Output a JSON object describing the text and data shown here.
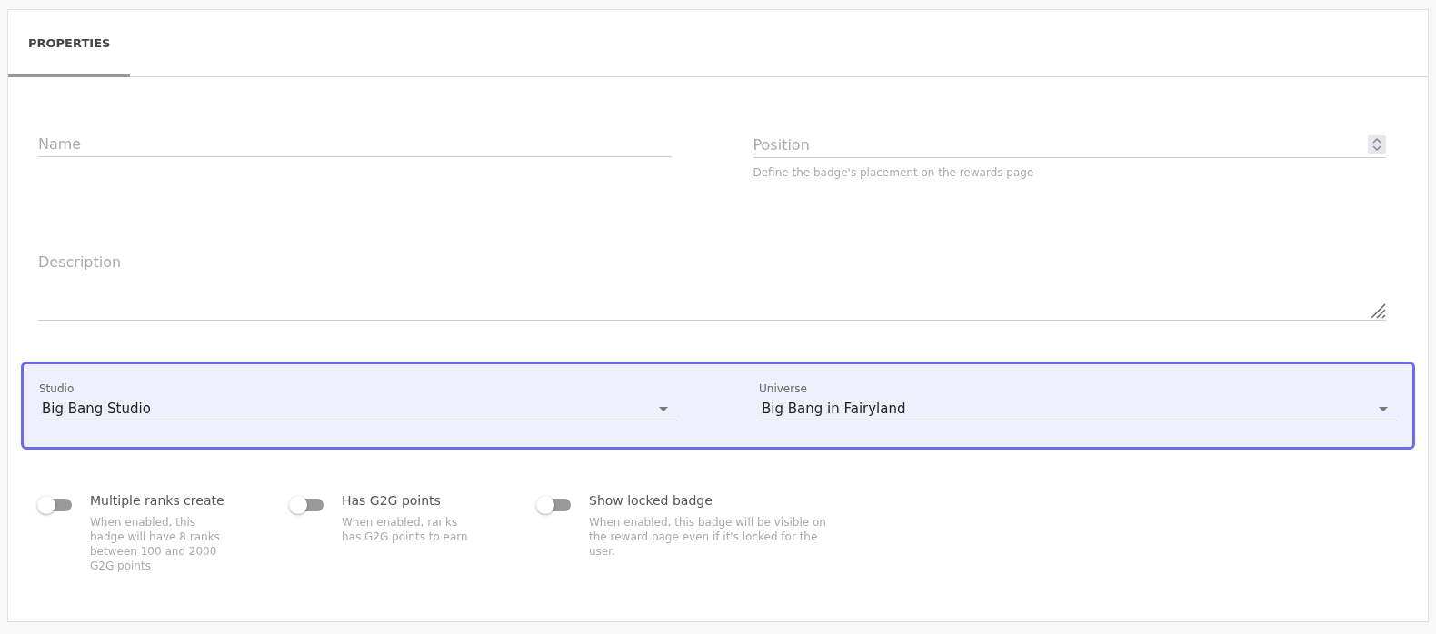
{
  "tabs": [
    {
      "label": "PROPERTIES",
      "selected": true
    }
  ],
  "fields": {
    "name": {
      "placeholder": "Name"
    },
    "position": {
      "placeholder": "Position",
      "help": "Define the badge's placement on the rewards page"
    },
    "description": {
      "placeholder": "Description"
    }
  },
  "selects": [
    {
      "label": "Studio",
      "value": "Big Bang Studio"
    },
    {
      "label": "Universe",
      "value": "Big Bang in Fairyland"
    }
  ],
  "toggles": [
    {
      "label": "Multiple ranks create",
      "help": "When enabled, this badge will have 8 ranks between 100 and 2000 G2G points",
      "on": false
    },
    {
      "label": "Has G2G points",
      "help": "When enabled, ranks has G2G points to earn",
      "on": false
    },
    {
      "label": "Show locked badge",
      "help": "When enabled, this badge will be visible on the reward page even if it's locked for the user.",
      "on": false
    }
  ]
}
